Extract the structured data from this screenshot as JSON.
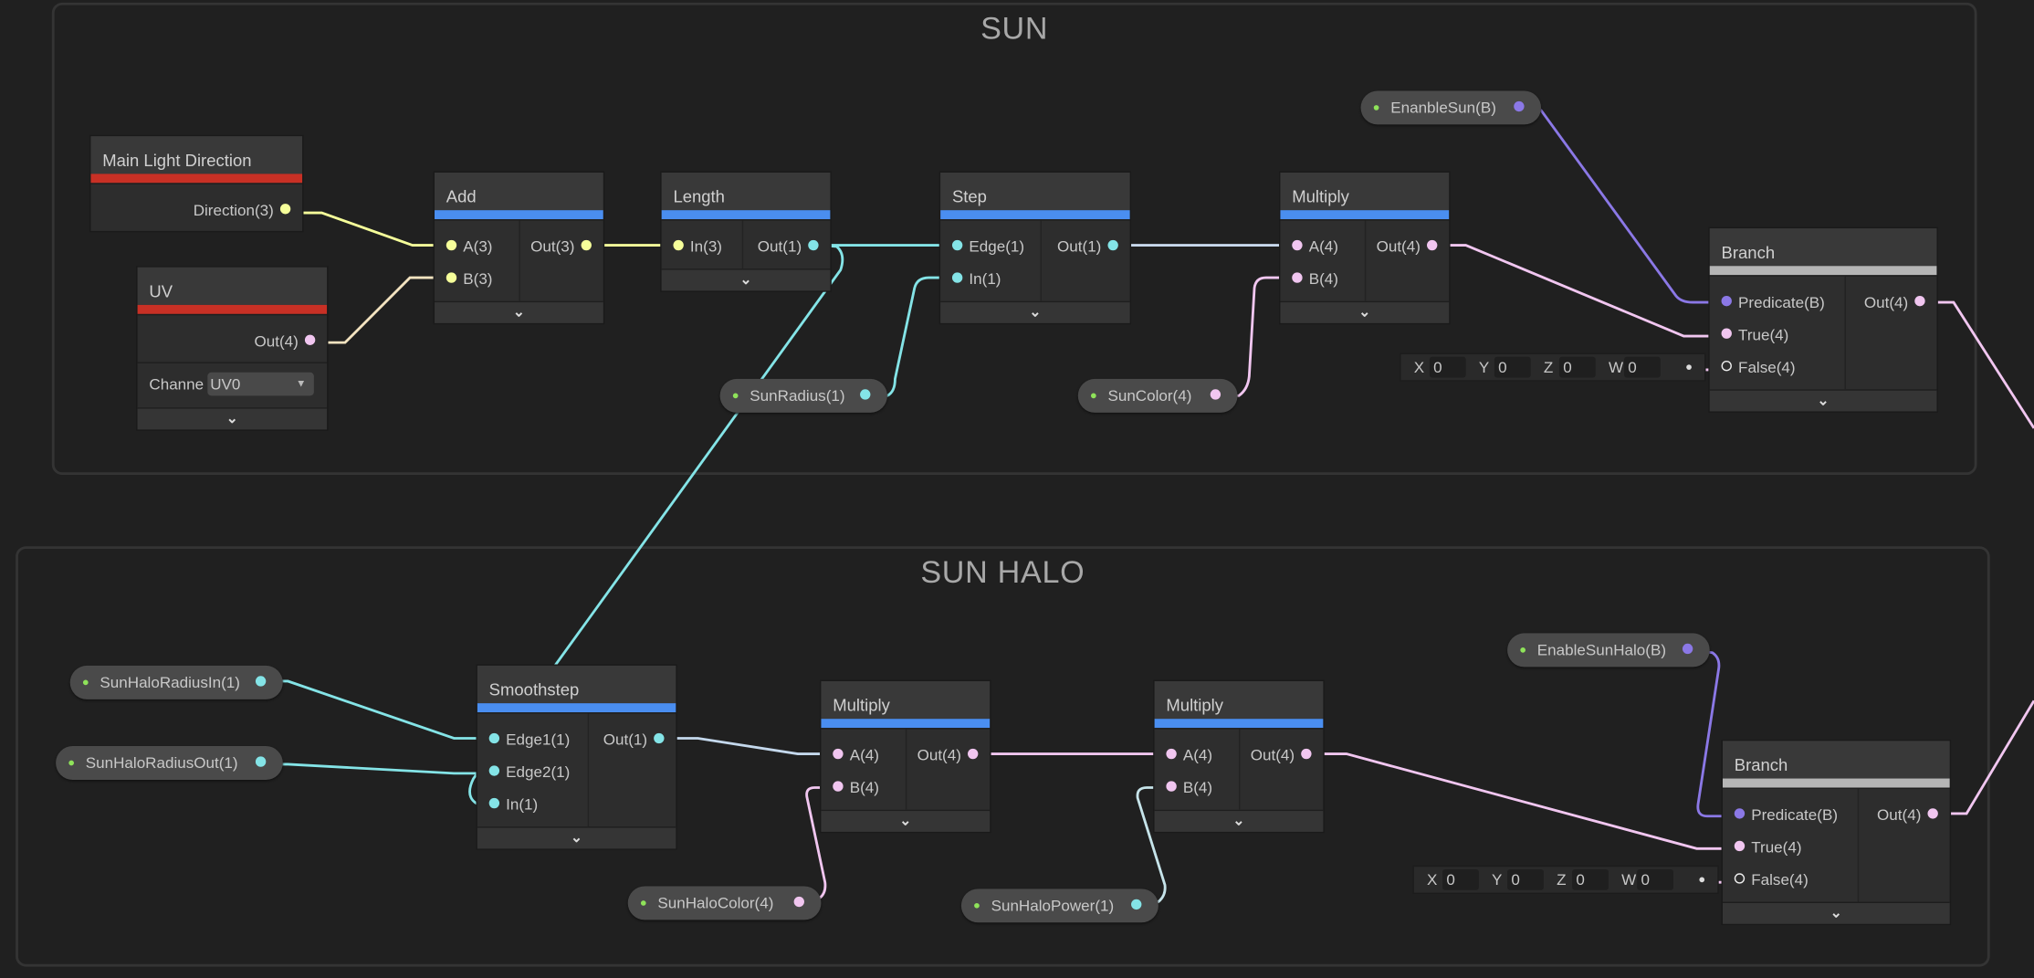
{
  "groups": [
    {
      "title": "SUN"
    },
    {
      "title": "SUN HALO"
    }
  ],
  "port_colors": {
    "1": "#84e4e7",
    "3": "#f6ff9a",
    "4": "#f1c6f0",
    "B": "#8b78e6",
    "empty": "#ffffff"
  },
  "accent_colors": {
    "property": "#c83025",
    "math": "#4a8ef0",
    "branch": "#b5b5b5"
  },
  "expand_glyph": "⌄",
  "nodes": [
    {
      "title": "Main Light Direction",
      "accent": "#c83025",
      "inputs": [],
      "outputs": [
        {
          "label": "Direction(3)",
          "type": "3"
        }
      ]
    },
    {
      "title": "UV",
      "accent": "#c83025",
      "inputs": [],
      "outputs": [
        {
          "label": "Out(4)",
          "type": "4"
        }
      ],
      "channel_label": "Channe",
      "channel_value": "UV0"
    },
    {
      "title": "Add",
      "accent": "#4a8ef0",
      "inputs": [
        {
          "label": "A(3)",
          "type": "3"
        },
        {
          "label": "B(3)",
          "type": "3"
        }
      ],
      "outputs": [
        {
          "label": "Out(3)",
          "type": "3"
        }
      ]
    },
    {
      "title": "Length",
      "accent": "#4a8ef0",
      "inputs": [
        {
          "label": "In(3)",
          "type": "3"
        }
      ],
      "outputs": [
        {
          "label": "Out(1)",
          "type": "1"
        }
      ]
    },
    {
      "title": "Step",
      "accent": "#4a8ef0",
      "inputs": [
        {
          "label": "Edge(1)",
          "type": "1"
        },
        {
          "label": "In(1)",
          "type": "1"
        }
      ],
      "outputs": [
        {
          "label": "Out(1)",
          "type": "1"
        }
      ]
    },
    {
      "title": "Multiply",
      "accent": "#4a8ef0",
      "inputs": [
        {
          "label": "A(4)",
          "type": "4"
        },
        {
          "label": "B(4)",
          "type": "4"
        }
      ],
      "outputs": [
        {
          "label": "Out(4)",
          "type": "4"
        }
      ]
    },
    {
      "title": "Branch",
      "accent": "#b5b5b5",
      "inputs": [
        {
          "label": "Predicate(B)",
          "type": "B"
        },
        {
          "label": "True(4)",
          "type": "4"
        },
        {
          "label": "False(4)",
          "type": "empty"
        }
      ],
      "outputs": [
        {
          "label": "Out(4)",
          "type": "4"
        }
      ]
    },
    {
      "title": "Smoothstep",
      "accent": "#4a8ef0",
      "inputs": [
        {
          "label": "Edge1(1)",
          "type": "1"
        },
        {
          "label": "Edge2(1)",
          "type": "1"
        },
        {
          "label": "In(1)",
          "type": "1"
        }
      ],
      "outputs": [
        {
          "label": "Out(1)",
          "type": "1"
        }
      ]
    },
    {
      "title": "Multiply",
      "accent": "#4a8ef0",
      "inputs": [
        {
          "label": "A(4)",
          "type": "4"
        },
        {
          "label": "B(4)",
          "type": "4"
        }
      ],
      "outputs": [
        {
          "label": "Out(4)",
          "type": "4"
        }
      ]
    },
    {
      "title": "Multiply",
      "accent": "#4a8ef0",
      "inputs": [
        {
          "label": "A(4)",
          "type": "4"
        },
        {
          "label": "B(4)",
          "type": "4"
        }
      ],
      "outputs": [
        {
          "label": "Out(4)",
          "type": "4"
        }
      ]
    },
    {
      "title": "Branch",
      "accent": "#b5b5b5",
      "inputs": [
        {
          "label": "Predicate(B)",
          "type": "B"
        },
        {
          "label": "True(4)",
          "type": "4"
        },
        {
          "label": "False(4)",
          "type": "empty"
        }
      ],
      "outputs": [
        {
          "label": "Out(4)",
          "type": "4"
        }
      ]
    }
  ],
  "properties": [
    {
      "label": "EnanbleSun(B)",
      "type": "B"
    },
    {
      "label": "SunRadius(1)",
      "type": "1"
    },
    {
      "label": "SunColor(4)",
      "type": "4"
    },
    {
      "label": "EnableSunHalo(B)",
      "type": "B"
    },
    {
      "label": "SunHaloRadiusIn(1)",
      "type": "1"
    },
    {
      "label": "SunHaloRadiusOut(1)",
      "type": "1"
    },
    {
      "label": "SunHaloColor(4)",
      "type": "4"
    },
    {
      "label": "SunHaloPower(1)",
      "type": "1"
    }
  ],
  "inline_vectors": [
    {
      "labels": [
        "X",
        "Y",
        "Z",
        "W"
      ],
      "values": [
        "0",
        "0",
        "0",
        "0"
      ]
    },
    {
      "labels": [
        "X",
        "Y",
        "Z",
        "W"
      ],
      "values": [
        "0",
        "0",
        "0",
        "0"
      ]
    }
  ]
}
